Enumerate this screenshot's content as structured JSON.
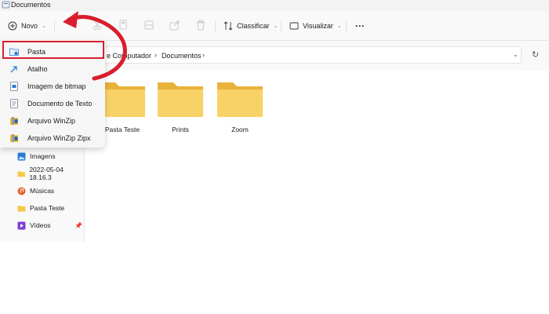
{
  "window": {
    "title": "Documentos"
  },
  "toolbar": {
    "new_label": "Novo",
    "sort_label": "Classificar",
    "view_label": "Visualizar",
    "more_label": "···"
  },
  "address": {
    "crumbs": [
      "e Computador",
      "Documentos"
    ],
    "separator": "›",
    "dropdown": "⌄",
    "refresh": "↻"
  },
  "new_menu": {
    "items": [
      {
        "label": "Pasta",
        "icon": "new-folder-icon"
      },
      {
        "label": "Atalho",
        "icon": "shortcut-icon"
      },
      {
        "label": "Imagem de bitmap",
        "icon": "bitmap-image-icon"
      },
      {
        "label": "Documento de Texto",
        "icon": "text-document-icon"
      },
      {
        "label": "Arquivo WinZip",
        "icon": "winzip-icon"
      },
      {
        "label": "Arquivo WinZip Zipx",
        "icon": "winzip-zipx-icon"
      }
    ]
  },
  "sidebar": {
    "items": [
      {
        "label": "Imagens",
        "icon": "pictures-icon",
        "pinned": true
      },
      {
        "label": "2022-05-04 18.16.3",
        "icon": "folder-icon"
      },
      {
        "label": "Músicas",
        "icon": "music-icon"
      },
      {
        "label": "Pasta Teste",
        "icon": "folder-icon"
      },
      {
        "label": "Vídeos",
        "icon": "videos-icon"
      }
    ]
  },
  "folders": [
    {
      "name": "Pasta Teste"
    },
    {
      "name": "Prints"
    },
    {
      "name": "Zoom"
    }
  ],
  "colors": {
    "highlight": "#d81e2c",
    "folder": "#f7c948",
    "accent": "#0067c0"
  }
}
